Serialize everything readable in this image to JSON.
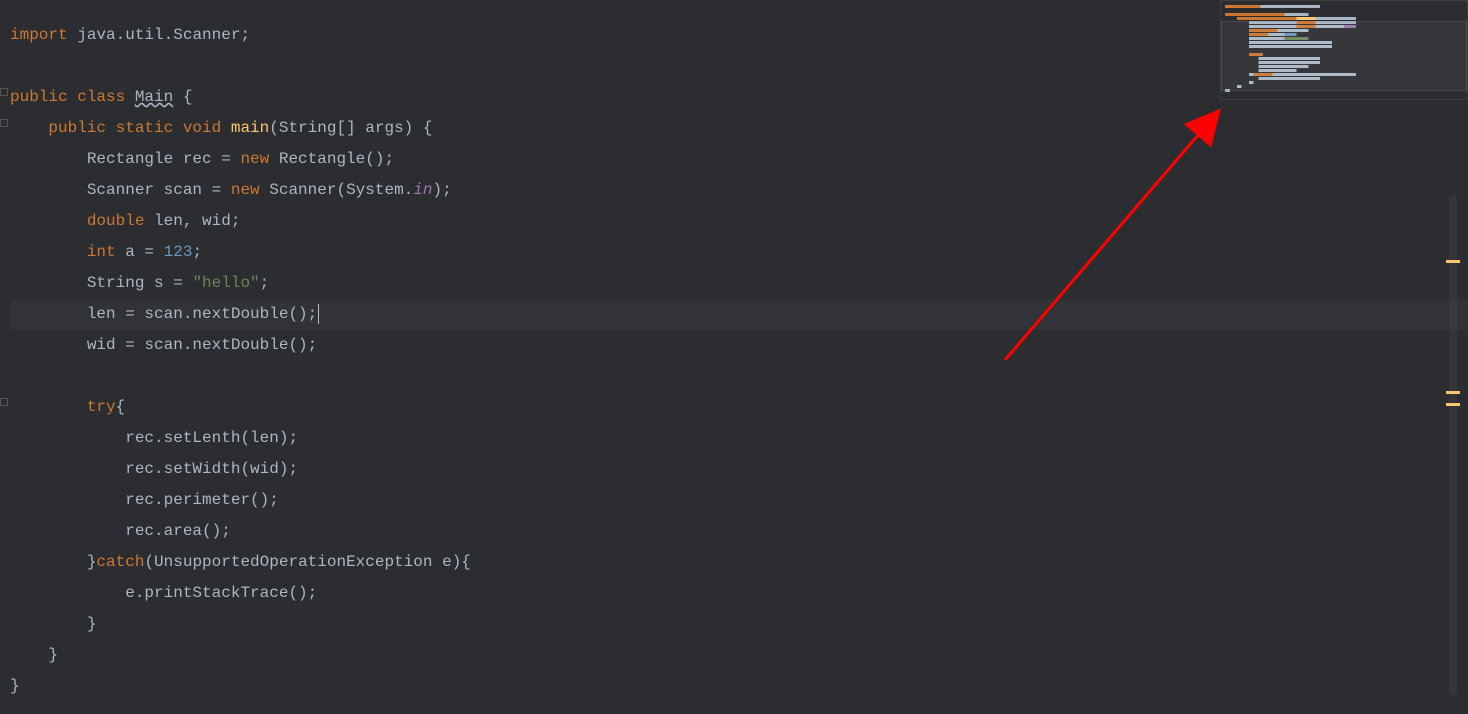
{
  "code": {
    "line1": {
      "kw": "import ",
      "pkg": "java.util.Scanner",
      "semi": ";"
    },
    "line3": {
      "kw1": "public class ",
      "name": "Main",
      "brace": " {"
    },
    "line4": {
      "indent": "    ",
      "kw": "public static void ",
      "method": "main",
      "params": "(String[] args) {"
    },
    "line5": {
      "indent": "        ",
      "type": "Rectangle ",
      "var": "rec = ",
      "kw": "new ",
      "ctor": "Rectangle();"
    },
    "line6": {
      "indent": "        ",
      "type": "Scanner ",
      "var": "scan = ",
      "kw": "new ",
      "ctor": "Scanner(System.",
      "field": "in",
      "end": ");"
    },
    "line7": {
      "indent": "        ",
      "kw": "double ",
      "vars": "len, wid;"
    },
    "line8": {
      "indent": "        ",
      "kw": "int ",
      "var": "a = ",
      "num": "123",
      "semi": ";"
    },
    "line9": {
      "indent": "        ",
      "type": "String ",
      "var": "s = ",
      "str": "\"hello\"",
      "semi": ";"
    },
    "line10": {
      "indent": "        ",
      "code": "len = scan.nextDouble();"
    },
    "line11": {
      "indent": "        ",
      "code": "wid = scan.nextDouble();"
    },
    "line13": {
      "indent": "        ",
      "kw": "try",
      "brace": "{"
    },
    "line14": {
      "indent": "            ",
      "code": "rec.setLenth(len);"
    },
    "line15": {
      "indent": "            ",
      "code": "rec.setWidth(wid);"
    },
    "line16": {
      "indent": "            ",
      "code": "rec.perimeter();"
    },
    "line17": {
      "indent": "            ",
      "code": "rec.area();"
    },
    "line18": {
      "indent": "        ",
      "brace": "}",
      "kw": "catch",
      "params": "(UnsupportedOperationException e){"
    },
    "line19": {
      "indent": "            ",
      "code": "e.printStackTrace();"
    },
    "line20": {
      "indent": "        ",
      "brace": "}"
    },
    "line21": {
      "indent": "    ",
      "brace": "}"
    },
    "line22": {
      "brace": "}"
    }
  }
}
